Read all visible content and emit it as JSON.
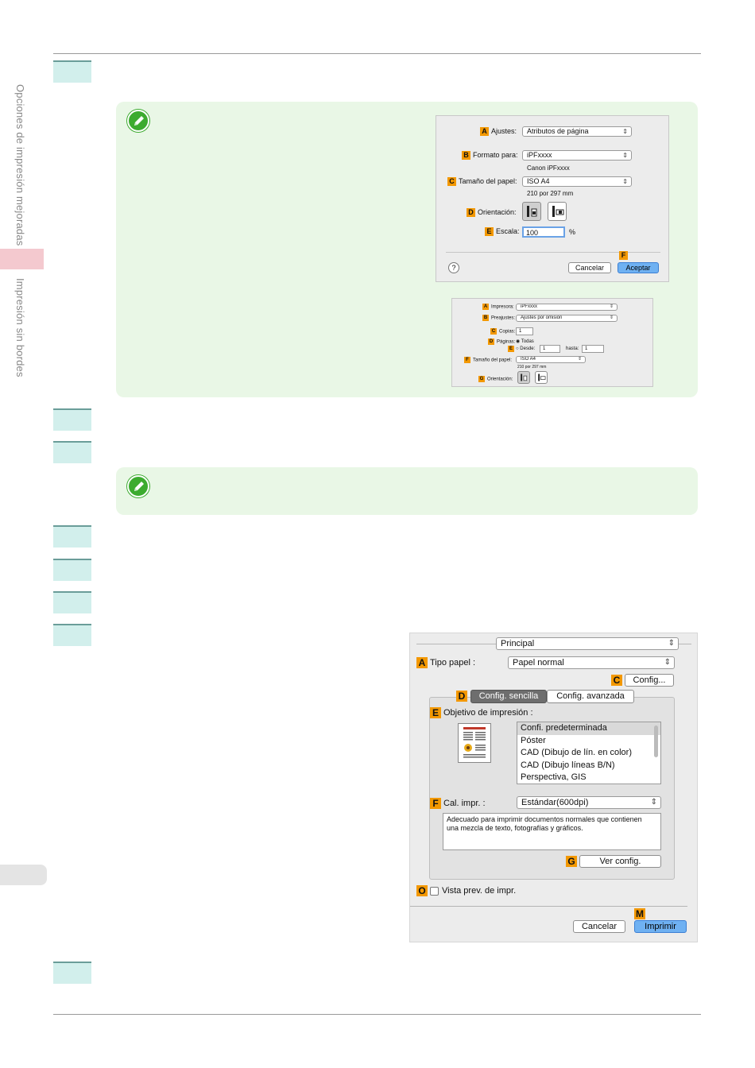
{
  "sidebar": {
    "section_1": "Opciones de impresión mejoradas",
    "section_2": "Impresión sin bordes"
  },
  "dialog_page_setup": {
    "settings_label": "Ajustes:",
    "settings_value": "Atributos de página",
    "format_label": "Formato para:",
    "format_value": "iPFxxxx",
    "format_sub": "Canon iPFxxxx",
    "paper_label": "Tamaño del papel:",
    "paper_value": "ISO A4",
    "paper_sub": "210 por 297 mm",
    "orientation_label": "Orientación:",
    "scale_label": "Escala:",
    "scale_value": "100",
    "scale_unit": "%",
    "help": "?",
    "cancel": "Cancelar",
    "ok": "Aceptar",
    "badges": [
      "A",
      "B",
      "C",
      "D",
      "E",
      "F"
    ]
  },
  "dialog_print_small": {
    "printer_label": "Impresora:",
    "printer_value": "iPFxxxx",
    "presets_label": "Preajustes:",
    "presets_value": "Ajustes por omisión",
    "copies_label": "Copias:",
    "copies_value": "1",
    "pages_label": "Páginas:",
    "pages_all": "Todas",
    "pages_from": "Desde:",
    "from_value": "1",
    "pages_to": "hasta:",
    "to_value": "1",
    "paper_label": "Tamaño del papel:",
    "paper_value": "ISO A4",
    "paper_sub": "210 por 297 mm",
    "orientation_label": "Orientación:",
    "badges": [
      "A",
      "B",
      "C",
      "D",
      "E",
      "F",
      "G"
    ]
  },
  "dialog_print_main": {
    "panel_value": "Principal",
    "paper_type_label": "Tipo papel :",
    "paper_type_value": "Papel normal",
    "config_button": "Config...",
    "tab_simple": "Config. sencilla",
    "tab_advanced": "Config. avanzada",
    "purpose_label": "Objetivo de impresión :",
    "purpose_items": [
      "Confi. predeterminada",
      "Póster",
      "CAD (Dibujo de lín. en color)",
      "CAD (Dibujo líneas B/N)",
      "Perspectiva, GIS"
    ],
    "quality_label": "Cal. impr. :",
    "quality_value": "Estándar(600dpi)",
    "description": "Adecuado para imprimir documentos normales que contienen una mezcla de texto, fotografías y gráficos.",
    "view_settings": "Ver config.",
    "preview_label": "Vista prev. de impr.",
    "cancel": "Cancelar",
    "print": "Imprimir",
    "badges": [
      "A",
      "C",
      "D",
      "E",
      "F",
      "G",
      "O",
      "M"
    ]
  }
}
